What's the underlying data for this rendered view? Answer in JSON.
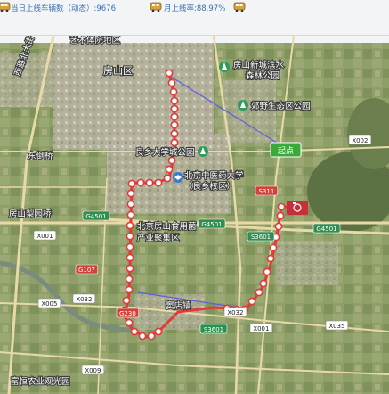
{
  "header": {
    "daily_vehicles": "当日上线车辆数（动态）:9676",
    "online_rate": "月上线率:88.97%",
    "icon": "bus-icon"
  },
  "colors": {
    "route_line": "#e23a3a",
    "stop_fill": "#ffffff",
    "connector": "#5b5fe0",
    "road_highway": "#e8d9a8",
    "start_badge": "#3aa83a"
  },
  "map": {
    "places": {
      "top_partial": "艺术体院地区",
      "fangshan_district": "房山区",
      "west_corridor": "西潞北大街",
      "dongjian": "东倒桥",
      "fangshan_lilu": "房山梨园桥",
      "liangxiang_park": "良乡大学城公园",
      "tcm_university": "北京中医药大学",
      "tcm_campus": "（良乡校区）",
      "food_industry_1": "北京房山食用菌",
      "food_industry_2": "产业聚集区",
      "xindao_town": "窦店镇",
      "agri_garden": "富恒农业观光园",
      "new_city_park_1": "房山新城滨水",
      "new_city_park_2": "森林公园",
      "suburb_park": "郊野生态区公园"
    },
    "start_label": "起点",
    "road_labels": {
      "x002": "X002",
      "g4501_a": "G4501",
      "g4501_b": "G4501",
      "g4501_c": "G4501",
      "s3601_a": "S3601",
      "s3601_b": "S3601",
      "x001": "X001",
      "x001_b": "X001",
      "x005": "X005",
      "x032_a": "X032",
      "x032_b": "X032",
      "x035": "X035",
      "x009": "X009",
      "g107": "G107",
      "g230": "G230",
      "s311": "S311"
    }
  }
}
